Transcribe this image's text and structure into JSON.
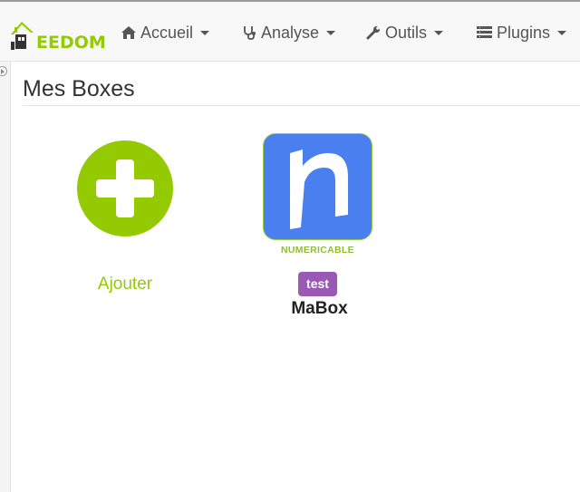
{
  "brand": {
    "logo_text": "EEDOM",
    "accent_color": "#94ca02"
  },
  "navbar": {
    "items": [
      {
        "label": "Accueil",
        "icon": "home-icon"
      },
      {
        "label": "Analyse",
        "icon": "stethoscope-icon"
      },
      {
        "label": "Outils",
        "icon": "wrench-icon"
      },
      {
        "label": "Plugins",
        "icon": "list-icon"
      }
    ]
  },
  "page": {
    "title": "Mes Boxes"
  },
  "add_card": {
    "label": "Ajouter",
    "icon": "plus-circle-icon"
  },
  "boxes": [
    {
      "logo_caption": "NUMERICABLE",
      "logo_letter": "n",
      "tag": "test",
      "tag_color": "#9b59b6",
      "name": "MaBox"
    }
  ]
}
